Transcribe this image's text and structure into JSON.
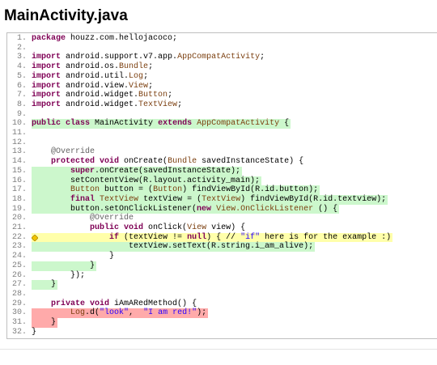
{
  "page": {
    "title": "MainActivity.java"
  },
  "colors": {
    "covered": "#ccf7cc",
    "partial": "#ffffaa",
    "missed": "#ffaaaa",
    "keyword": "#7f0055",
    "type": "#7b3f0f",
    "string": "#2a00ff"
  },
  "source": {
    "lines": [
      {
        "no": "1.",
        "cov": "",
        "icon": "",
        "indent": "",
        "tokens": [
          [
            "kw",
            "package"
          ],
          [
            "",
            "houzz.com.hellojacoco;"
          ]
        ]
      },
      {
        "no": "2.",
        "cov": "",
        "icon": "",
        "indent": "",
        "tokens": []
      },
      {
        "no": "3.",
        "cov": "",
        "icon": "",
        "indent": "",
        "tokens": [
          [
            "kw",
            "import"
          ],
          [
            "",
            "android.support.v7.app."
          ],
          [
            "ty",
            "AppCompatActivity"
          ],
          [
            "",
            ";"
          ]
        ]
      },
      {
        "no": "4.",
        "cov": "",
        "icon": "",
        "indent": "",
        "tokens": [
          [
            "kw",
            "import"
          ],
          [
            "",
            "android.os."
          ],
          [
            "ty",
            "Bundle"
          ],
          [
            "",
            ";"
          ]
        ]
      },
      {
        "no": "5.",
        "cov": "",
        "icon": "",
        "indent": "",
        "tokens": [
          [
            "kw",
            "import"
          ],
          [
            "",
            "android.util."
          ],
          [
            "ty",
            "Log"
          ],
          [
            "",
            ";"
          ]
        ]
      },
      {
        "no": "6.",
        "cov": "",
        "icon": "",
        "indent": "",
        "tokens": [
          [
            "kw",
            "import"
          ],
          [
            "",
            "android.view."
          ],
          [
            "ty",
            "View"
          ],
          [
            "",
            ";"
          ]
        ]
      },
      {
        "no": "7.",
        "cov": "",
        "icon": "",
        "indent": "",
        "tokens": [
          [
            "kw",
            "import"
          ],
          [
            "",
            "android.widget."
          ],
          [
            "ty",
            "Button"
          ],
          [
            "",
            ";"
          ]
        ]
      },
      {
        "no": "8.",
        "cov": "",
        "icon": "",
        "indent": "",
        "tokens": [
          [
            "kw",
            "import"
          ],
          [
            "",
            "android.widget."
          ],
          [
            "ty",
            "TextView"
          ],
          [
            "",
            ";"
          ]
        ]
      },
      {
        "no": "9.",
        "cov": "",
        "icon": "",
        "indent": "",
        "tokens": []
      },
      {
        "no": "10.",
        "cov": "full",
        "icon": "",
        "indent": "",
        "tokens": [
          [
            "kw",
            "public class"
          ],
          [
            "",
            "MainActivity"
          ],
          [
            "kw",
            "extends"
          ],
          [
            "ty",
            "AppCompatActivity"
          ],
          [
            "",
            "{"
          ]
        ]
      },
      {
        "no": "11.",
        "cov": "",
        "icon": "",
        "indent": "",
        "tokens": []
      },
      {
        "no": "12.",
        "cov": "",
        "icon": "",
        "indent": "",
        "tokens": []
      },
      {
        "no": "13.",
        "cov": "",
        "icon": "",
        "indent": "    ",
        "tokens": [
          [
            "ann",
            "@Override"
          ]
        ]
      },
      {
        "no": "14.",
        "cov": "",
        "icon": "",
        "indent": "    ",
        "tokens": [
          [
            "kw",
            "protected void"
          ],
          [
            "",
            "onCreate("
          ],
          [
            "ty",
            "Bundle"
          ],
          [
            "",
            "savedInstanceState) {"
          ]
        ]
      },
      {
        "no": "15.",
        "cov": "full",
        "icon": "",
        "indent": "        ",
        "tokens": [
          [
            "kw",
            "super"
          ],
          [
            "",
            ".onCreate(savedInstanceState);"
          ]
        ]
      },
      {
        "no": "16.",
        "cov": "full",
        "icon": "",
        "indent": "        ",
        "tokens": [
          [
            "",
            "setContentView(R.layout.activity_main);"
          ]
        ]
      },
      {
        "no": "17.",
        "cov": "full",
        "icon": "",
        "indent": "        ",
        "tokens": [
          [
            "ty",
            "Button"
          ],
          [
            "",
            "button = ("
          ],
          [
            "ty",
            "Button"
          ],
          [
            "",
            ") findViewById(R.id.button);"
          ]
        ]
      },
      {
        "no": "18.",
        "cov": "full",
        "icon": "",
        "indent": "        ",
        "tokens": [
          [
            "kw",
            "final"
          ],
          [
            "ty",
            "TextView"
          ],
          [
            "",
            "textView = ("
          ],
          [
            "ty",
            "TextView"
          ],
          [
            "",
            ") findViewById(R.id.textview);"
          ]
        ]
      },
      {
        "no": "19.",
        "cov": "full",
        "icon": "",
        "indent": "        ",
        "tokens": [
          [
            "",
            "button.setOnClickListener("
          ],
          [
            "kw",
            "new"
          ],
          [
            "ty",
            "View.OnClickListener"
          ],
          [
            "",
            "() {"
          ]
        ]
      },
      {
        "no": "20.",
        "cov": "",
        "icon": "",
        "indent": "            ",
        "tokens": [
          [
            "ann",
            "@Override"
          ]
        ]
      },
      {
        "no": "21.",
        "cov": "",
        "icon": "",
        "indent": "            ",
        "tokens": [
          [
            "kw",
            "public void"
          ],
          [
            "",
            "onClick("
          ],
          [
            "ty",
            "View"
          ],
          [
            "",
            "view) {"
          ]
        ]
      },
      {
        "no": "22.",
        "cov": "partial",
        "icon": "diamond",
        "indent": "                ",
        "tokens": [
          [
            "kw",
            "if"
          ],
          [
            "",
            "(textView !="
          ],
          [
            "kw",
            "null"
          ],
          [
            "",
            ") { //"
          ],
          [
            "str",
            "\"if\""
          ],
          [
            "",
            "here is for the example :)"
          ]
        ]
      },
      {
        "no": "23.",
        "cov": "full",
        "icon": "",
        "indent": "                    ",
        "tokens": [
          [
            "",
            "textView.setText(R.string.i_am_alive);"
          ]
        ]
      },
      {
        "no": "24.",
        "cov": "",
        "icon": "",
        "indent": "                ",
        "tokens": [
          [
            "",
            "}"
          ]
        ]
      },
      {
        "no": "25.",
        "cov": "full",
        "icon": "",
        "indent": "            ",
        "tokens": [
          [
            "",
            "}"
          ]
        ]
      },
      {
        "no": "26.",
        "cov": "",
        "icon": "",
        "indent": "        ",
        "tokens": [
          [
            "",
            "});"
          ]
        ]
      },
      {
        "no": "27.",
        "cov": "full",
        "icon": "",
        "indent": "    ",
        "tokens": [
          [
            "",
            "}"
          ]
        ]
      },
      {
        "no": "28.",
        "cov": "",
        "icon": "",
        "indent": "",
        "tokens": []
      },
      {
        "no": "29.",
        "cov": "",
        "icon": "",
        "indent": "    ",
        "tokens": [
          [
            "kw",
            "private void"
          ],
          [
            "",
            "iAmARedMethod() {"
          ]
        ]
      },
      {
        "no": "30.",
        "cov": "none",
        "icon": "",
        "indent": "        ",
        "tokens": [
          [
            "ty",
            "Log"
          ],
          [
            "",
            ".d("
          ],
          [
            "str",
            "\"look\""
          ],
          [
            "",
            ", "
          ],
          [
            "str",
            "\"I am red!\""
          ],
          [
            "",
            ");"
          ]
        ]
      },
      {
        "no": "31.",
        "cov": "none",
        "icon": "",
        "indent": "    ",
        "tokens": [
          [
            "",
            "}"
          ]
        ]
      },
      {
        "no": "32.",
        "cov": "",
        "icon": "",
        "indent": "",
        "tokens": [
          [
            "",
            "}"
          ]
        ]
      }
    ]
  }
}
